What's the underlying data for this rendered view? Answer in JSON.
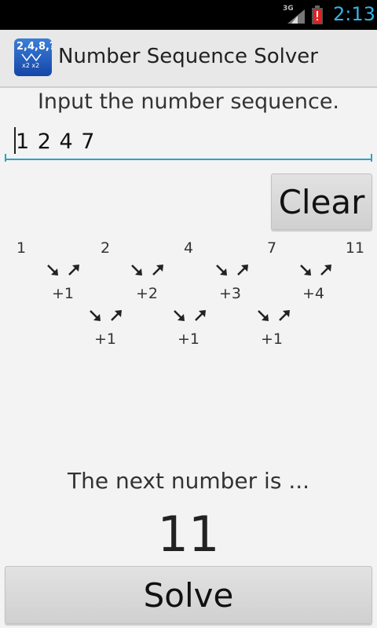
{
  "status_bar": {
    "network": "3G",
    "time": "2:13"
  },
  "action_bar": {
    "title": "Number Sequence Solver",
    "icon_text_top": "2,4,8,?",
    "icon_text_bottom": "x2  x2",
    "icon": "app-icon"
  },
  "main": {
    "prompt": "Input the number sequence.",
    "sequence_value": "1 2 4 7",
    "clear_label": "Clear",
    "diagram": {
      "row0": [
        "1",
        "2",
        "4",
        "7",
        "11"
      ],
      "row1": [
        "+1",
        "+2",
        "+3",
        "+4"
      ],
      "row2": [
        "+1",
        "+1",
        "+1"
      ]
    },
    "next_label": "The next number is ...",
    "answer": "11",
    "solve_label": "Solve"
  },
  "colors": {
    "accent": "#33b5e5",
    "underline": "#2aa3c9"
  }
}
